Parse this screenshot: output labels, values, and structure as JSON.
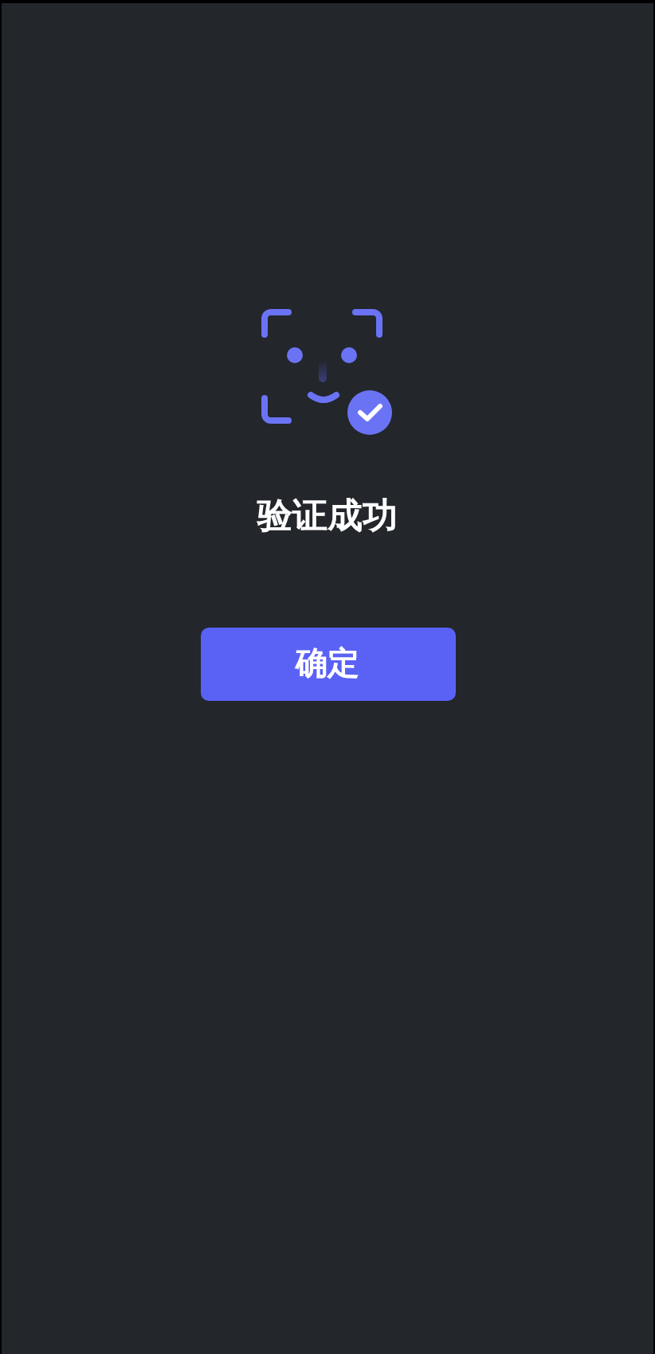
{
  "title": "验证成功",
  "button": {
    "label": "确定"
  }
}
